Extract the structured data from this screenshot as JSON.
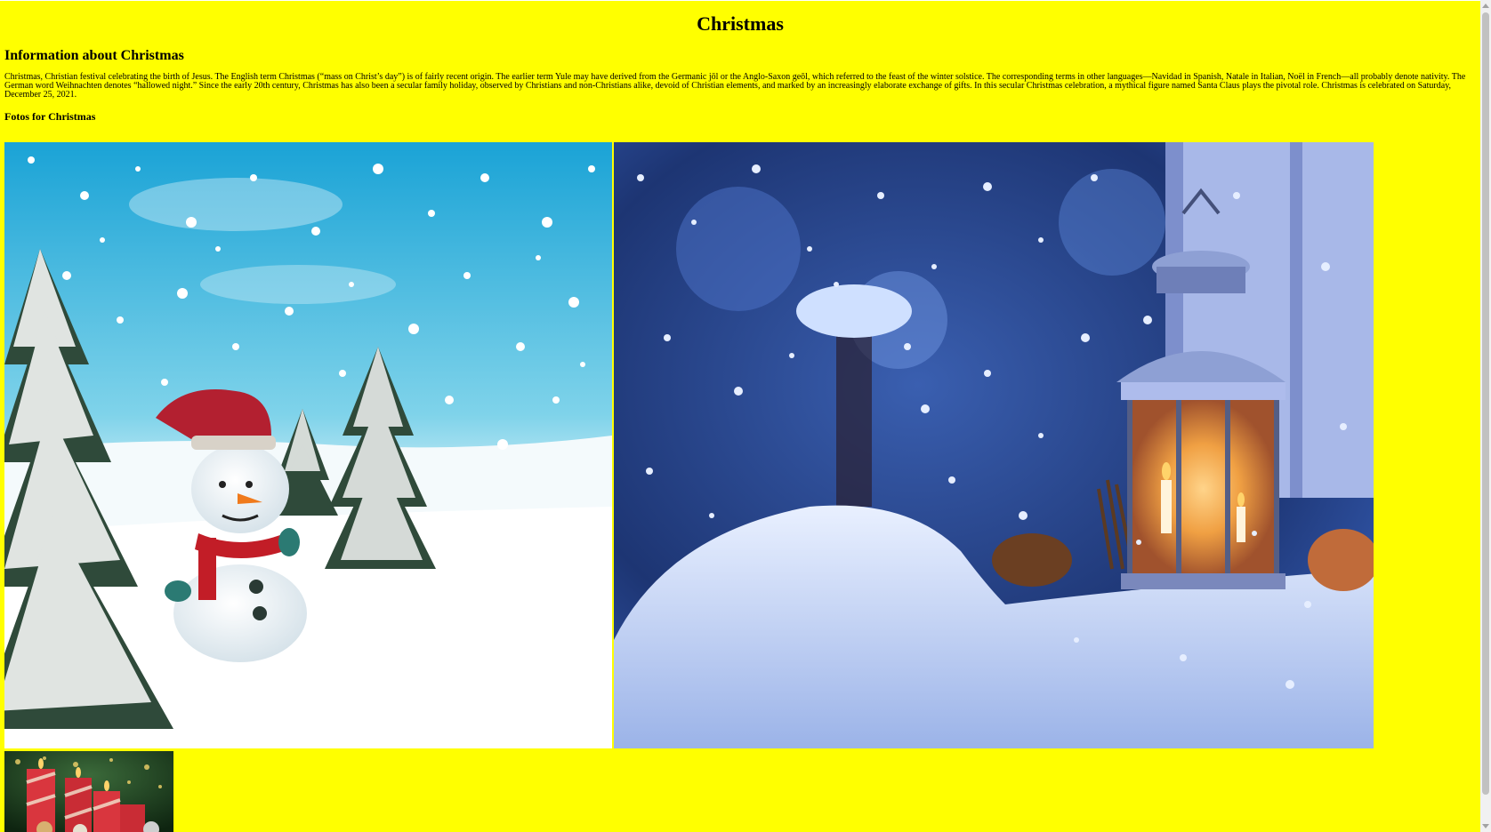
{
  "page": {
    "title": "Christmas",
    "background_color": "#ffff00"
  },
  "info": {
    "heading": "Information about Christmas",
    "text": "Christmas, Christian festival celebrating the birth of Jesus. The English term Christmas (“mass on Christ’s day”) is of fairly recent origin. The earlier term Yule may have derived from the Germanic jōl or the Anglo-Saxon geōl, which referred to the feast of the winter solstice. The corresponding terms in other languages—Navidad in Spanish, Natale in Italian, Noël in French—all probably denote nativity. The German word Weihnachten denotes “hallowed night.” Since the early 20th century, Christmas has also been a secular family holiday, observed by Christians and non-Christians alike, devoid of Christian elements, and marked by an increasingly elaborate exchange of gifts. In this secular Christmas celebration, a mythical figure named Santa Claus plays the pivotal role. Christmas is celebrated on Saturday, December 25, 2021."
  },
  "photos": {
    "heading": "Fotos for Christmas",
    "items": [
      {
        "subject": "snowman-in-snowy-forest"
      },
      {
        "subject": "lantern-in-snow"
      },
      {
        "subject": "advent-candles"
      }
    ]
  }
}
